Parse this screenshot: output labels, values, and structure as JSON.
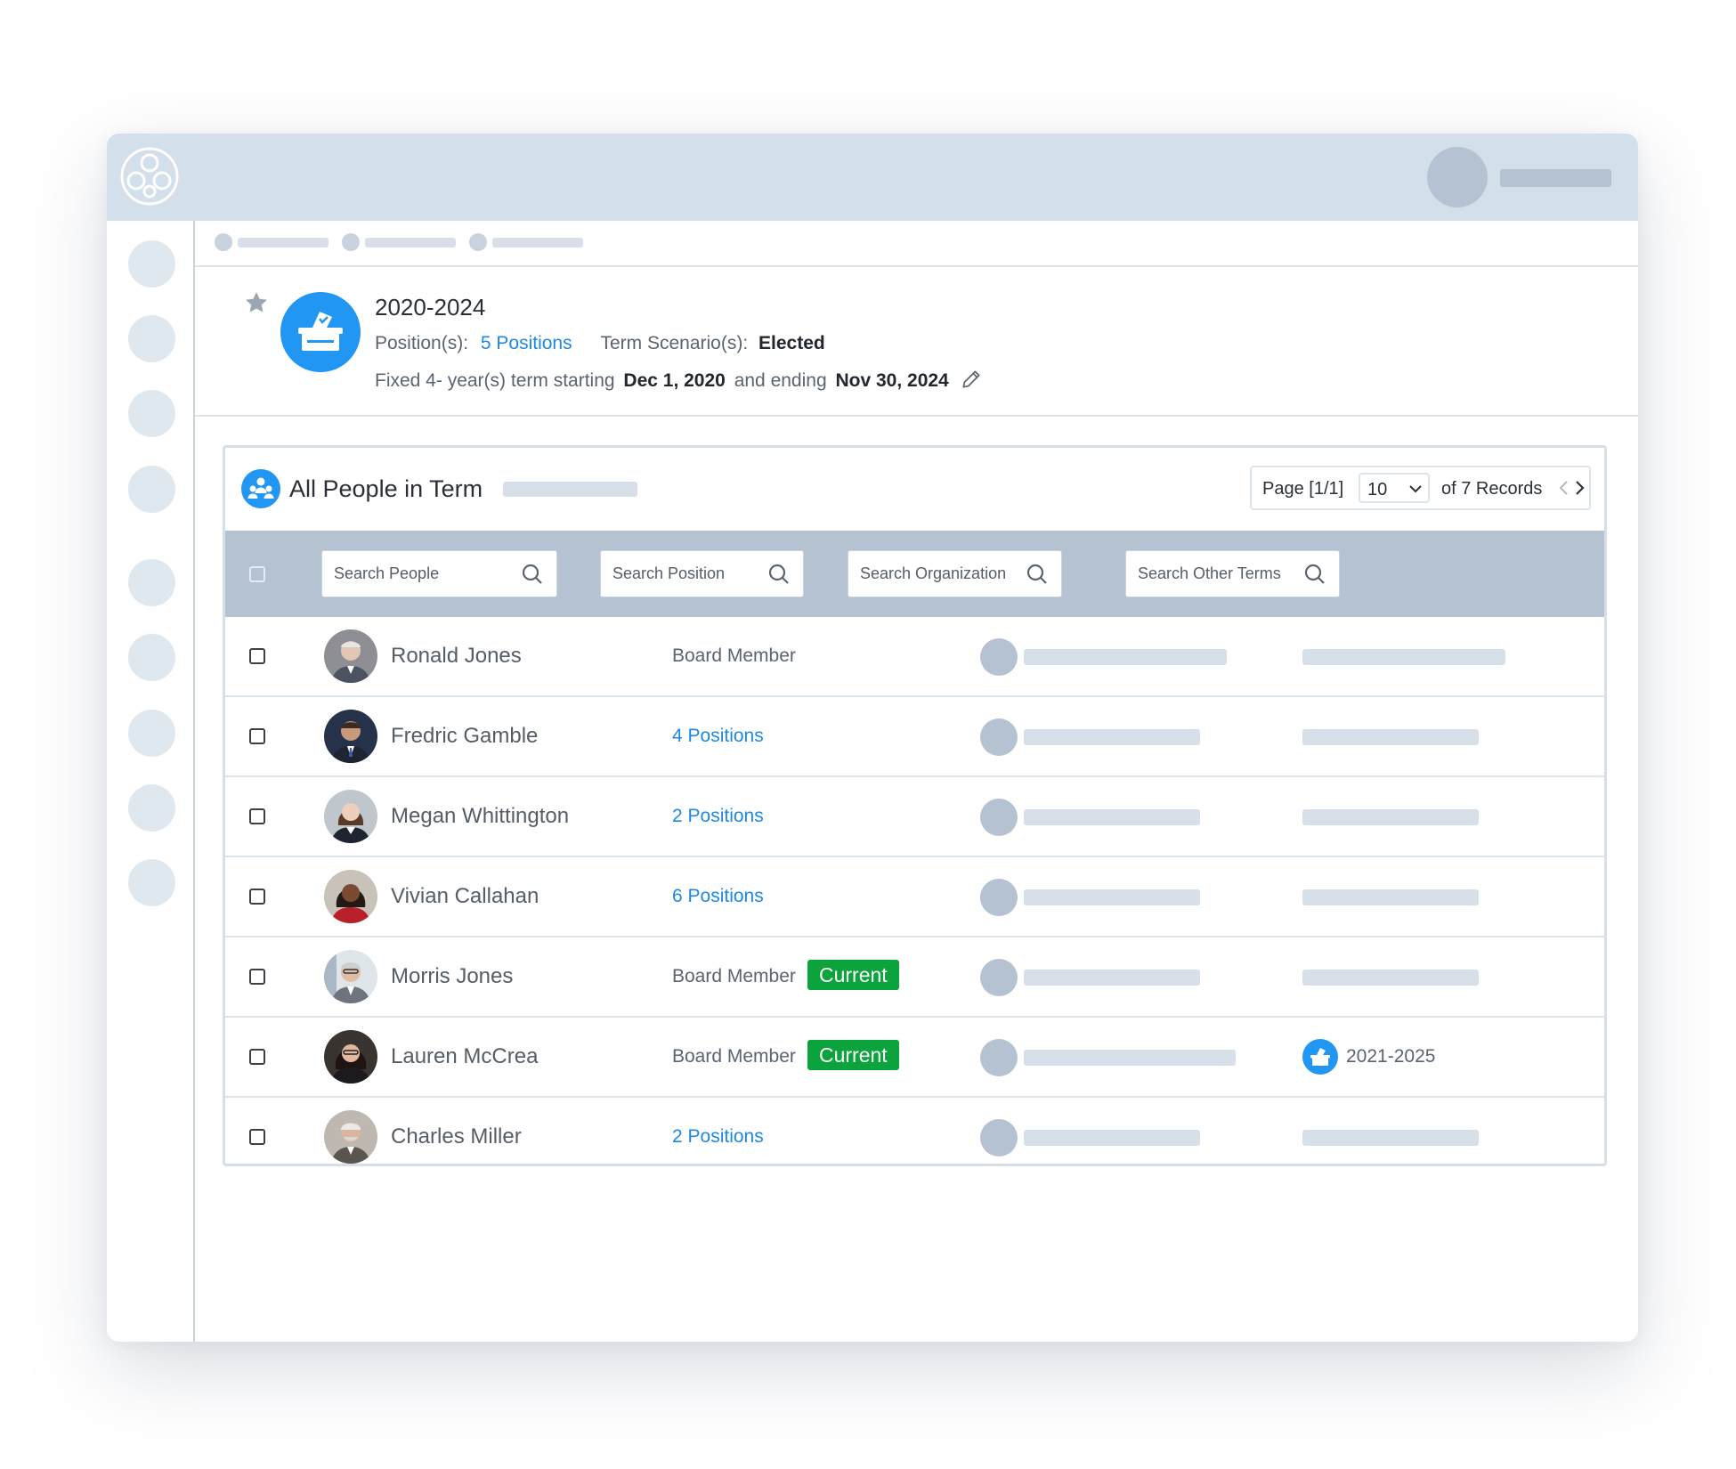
{
  "term": {
    "title": "2020-2024",
    "positions_label": "Position(s):",
    "positions_link": "5 Positions",
    "scenario_label": "Term Scenario(s):",
    "scenario_value": "Elected",
    "duration_prefix": "Fixed 4- year(s) term starting",
    "start_date": "Dec 1, 2020",
    "and_ending": "and ending",
    "end_date": "Nov 30, 2024"
  },
  "panel": {
    "title": "All People in Term",
    "pager": {
      "page_label": "Page [1/1]",
      "page_size": "10",
      "records_label": "of 7 Records"
    }
  },
  "filters": {
    "people_placeholder": "Search People",
    "position_placeholder": "Search Position",
    "organization_placeholder": "Search Organization",
    "other_terms_placeholder": "Search Other Terms"
  },
  "rows": [
    {
      "name": "Ronald Jones",
      "position": "Board Member",
      "position_is_link": false,
      "current": false
    },
    {
      "name": "Fredric Gamble",
      "position": "4 Positions",
      "position_is_link": true,
      "current": false
    },
    {
      "name": "Megan Whittington",
      "position": "2 Positions",
      "position_is_link": true,
      "current": false
    },
    {
      "name": "Vivian Callahan",
      "position": "6 Positions",
      "position_is_link": true,
      "current": false
    },
    {
      "name": "Morris Jones",
      "position": "Board Member",
      "position_is_link": false,
      "current": true,
      "badge": "Current"
    },
    {
      "name": "Lauren McCrea",
      "position": "Board Member",
      "position_is_link": false,
      "current": true,
      "badge": "Current",
      "other_term": "2021-2025"
    },
    {
      "name": "Charles Miller",
      "position": "2 Positions",
      "position_is_link": true,
      "current": false
    }
  ],
  "colors": {
    "accent": "#2196f3",
    "link": "#1e88e5",
    "current_badge": "#0aa33c",
    "topbar": "#d3dfea",
    "filter_row": "#b4c2d2"
  },
  "icons": {
    "logo": "network-logo-icon",
    "favorite": "star-icon",
    "term": "ballot-box-icon",
    "people": "people-group-icon",
    "edit": "pencil-icon",
    "search": "search-icon"
  }
}
